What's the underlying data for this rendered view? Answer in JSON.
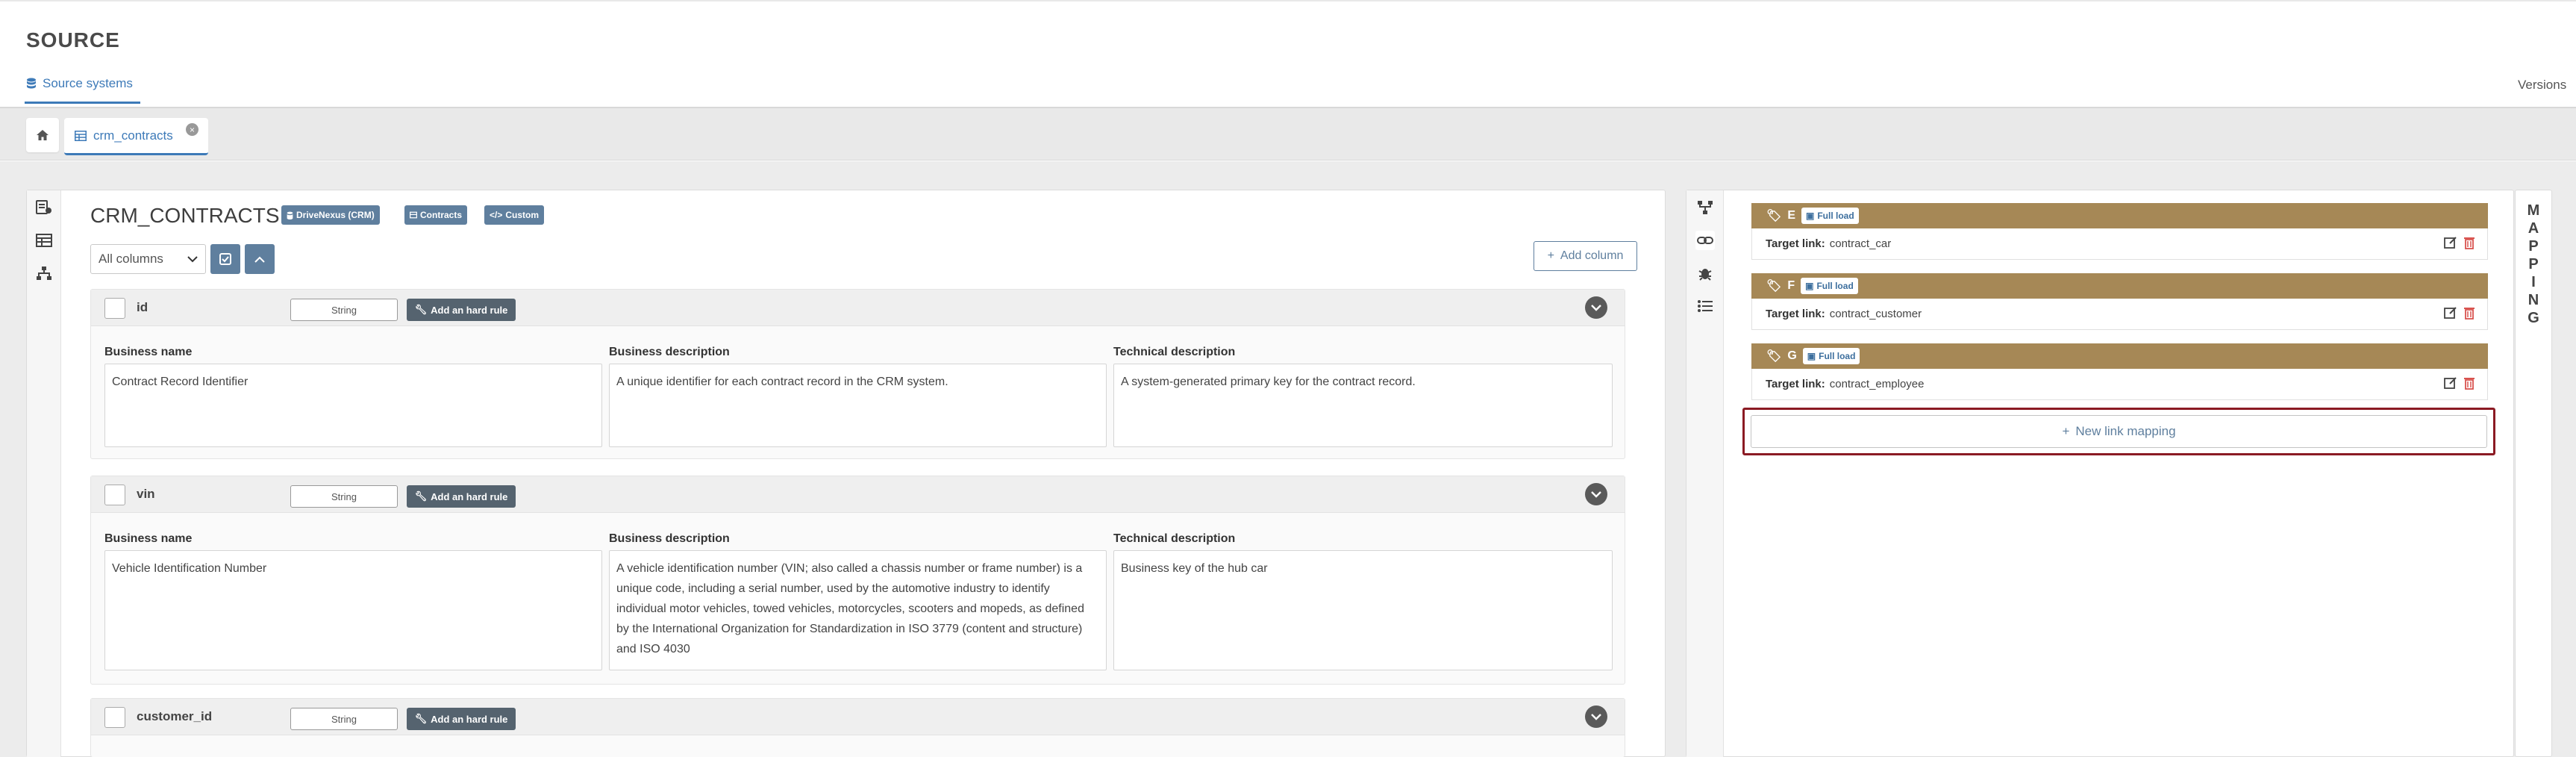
{
  "header": {
    "title": "SOURCE",
    "nav_tab": "Source systems",
    "versions": "Versions"
  },
  "tabs": {
    "open_tab": "crm_contracts",
    "close": "×"
  },
  "table": {
    "title": "CRM_CONTRACTS",
    "badges": [
      "DriveNexus (CRM)",
      "Contracts",
      "Custom"
    ],
    "columns_filter": "All columns",
    "add_column": "Add column"
  },
  "field_labels": {
    "business_name": "Business name",
    "business_description": "Business description",
    "technical_description": "Technical description"
  },
  "columns": [
    {
      "name": "id",
      "type": "String",
      "hard_rule": "Add an hard rule",
      "business_name": "Contract Record Identifier",
      "business_description": "A unique identifier for each contract record in the CRM system.",
      "technical_description": "A system-generated primary key for the contract record."
    },
    {
      "name": "vin",
      "type": "String",
      "hard_rule": "Add an hard rule",
      "business_name": "Vehicle Identification Number",
      "business_description": "A vehicle identification number (VIN; also called a chassis number or frame number) is a unique code, including a serial number, used by the automotive industry to identify individual motor vehicles, towed vehicles, motorcycles, scooters and mopeds, as defined by the International Organization for Standardization in ISO 3779 (content and structure) and ISO 4030",
      "technical_description": "Business key of the hub car"
    },
    {
      "name": "customer_id",
      "type": "String",
      "hard_rule": "Add an hard rule"
    }
  ],
  "mappings": [
    {
      "letter": "E",
      "load": "Full load",
      "label": "Target link:",
      "target": "contract_car"
    },
    {
      "letter": "F",
      "load": "Full load",
      "label": "Target link:",
      "target": "contract_customer"
    },
    {
      "letter": "G",
      "load": "Full load",
      "label": "Target link:",
      "target": "contract_employee"
    }
  ],
  "new_mapping": "New link mapping",
  "side_title": [
    "M",
    "A",
    "P",
    "P",
    "I",
    "N",
    "G"
  ],
  "colors": {
    "accent": "#3d7ab8",
    "badge": "#5f7f9e",
    "mapping_bar": "#a68856",
    "highlight": "#8b1a23",
    "delete": "#d9534f"
  }
}
